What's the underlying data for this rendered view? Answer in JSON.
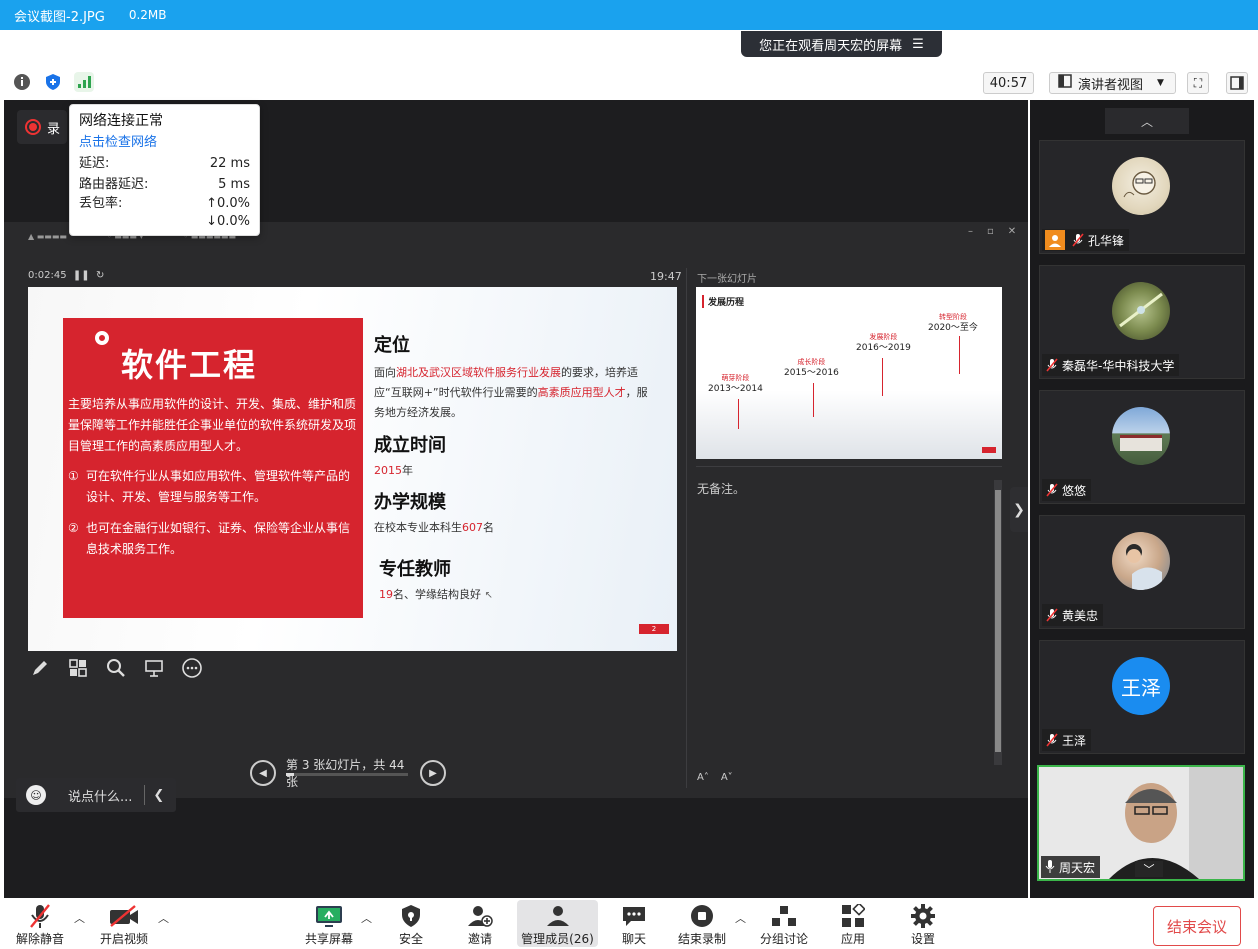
{
  "titlebar": {
    "filename": "会议截图-2.JPG",
    "filesize": "0.2MB"
  },
  "watching": {
    "text": "您正在观看周天宏的屏幕"
  },
  "topbar": {
    "timer": "40:57",
    "view_label": "演讲者视图"
  },
  "recording": {
    "label": "录"
  },
  "network": {
    "title": "网络连接正常",
    "check_link": "点击检查网络",
    "latency_label": "延迟:",
    "latency_value": "22 ms",
    "router_label": "路由器延迟:",
    "router_value": "5 ms",
    "loss_label": "丢包率:",
    "loss_up": "↑0.0%",
    "loss_down": "↓0.0%"
  },
  "presenter": {
    "elapsed": "0:02:45",
    "clock": "19:47",
    "next_label": "下一张幻灯片",
    "notes": "无备注。",
    "nav_text": "第 3 张幻灯片，共 44 张",
    "progress": 0.068
  },
  "slide": {
    "title": "软件工程",
    "intro": "主要培养从事应用软件的设计、开发、集成、维护和质量保障等工作并能胜任企事业单位的软件系统研发及项目管理工作的高素质应用型人才。",
    "item1_num": "①",
    "item1": "可在软件行业从事如应用软件、管理软件等产品的设计、开发、管理与服务等工作。",
    "item2_num": "②",
    "item2": "也可在金融行业如银行、证券、保险等企业从事信息技术服务工作。",
    "s1_h": "定位",
    "s1_a": "面向",
    "s1_b": "湖北及武汉区域软件服务行业发展",
    "s1_c": "的要求，培养适应“互联网+”时代软件行业需要的",
    "s1_d": "高素质应用型人才",
    "s1_e": "，服务地方经济发展。",
    "s2_h": "成立时间",
    "s2_year": "2015",
    "s2_suffix": "年",
    "s3_h": "办学规模",
    "s3_a": "在校本专业本科生",
    "s3_num": "607",
    "s3_b": "名",
    "s4_h": "专任教师",
    "s4_num": "19",
    "s4_b": "名、学缘结构良好",
    "page": "2"
  },
  "thumb": {
    "title": "发展历程",
    "stages": [
      {
        "tag": "萌芽阶段",
        "range": "2013～2014"
      },
      {
        "tag": "成长阶段",
        "range": "2015～2016"
      },
      {
        "tag": "发展阶段",
        "range": "2016～2019"
      },
      {
        "tag": "转型阶段",
        "range": "2020～至今"
      }
    ]
  },
  "participants": [
    {
      "name": "孔华锋",
      "host": true
    },
    {
      "name": "秦磊华-华中科技大学"
    },
    {
      "name": "悠悠"
    },
    {
      "name": "黄美忠"
    },
    {
      "name": "王泽",
      "initials": "王泽"
    },
    {
      "name": "周天宏",
      "speaking": true
    }
  ],
  "chat": {
    "placeholder": "说点什么..."
  },
  "toolbar": {
    "mute": "解除静音",
    "video": "开启视频",
    "share": "共享屏幕",
    "security": "安全",
    "invite": "邀请",
    "members": "管理成员(26)",
    "chat": "聊天",
    "stop_rec": "结束录制",
    "breakout": "分组讨论",
    "apps": "应用",
    "settings": "设置",
    "end": "结束会议"
  },
  "colors": {
    "accent_blue": "#1aa2ee",
    "slide_red": "#d6242e",
    "end_red": "#e14a4a",
    "active_border": "#3bb54a"
  }
}
